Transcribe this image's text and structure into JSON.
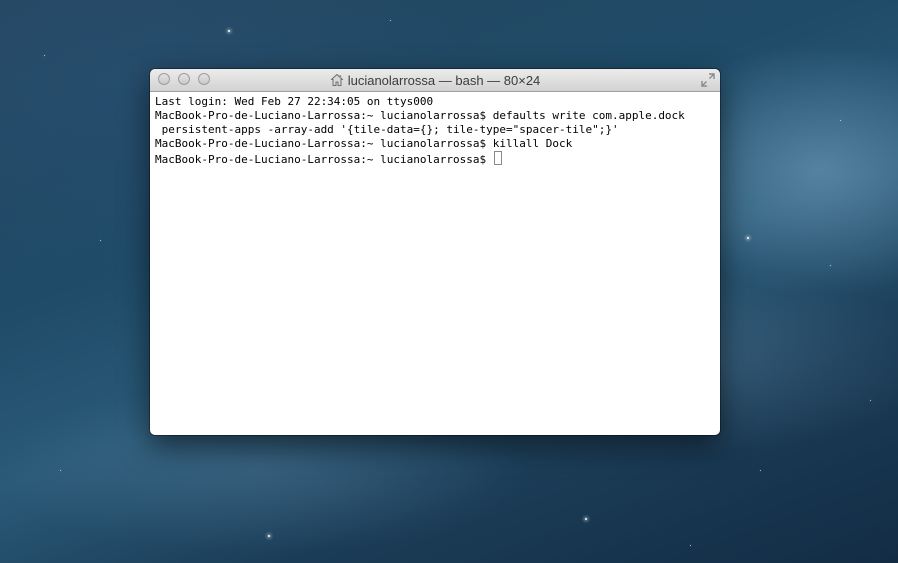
{
  "window": {
    "title": "lucianolarrossa — bash — 80×24"
  },
  "terminal": {
    "lines": [
      "Last login: Wed Feb 27 22:34:05 on ttys000",
      "MacBook-Pro-de-Luciano-Larrossa:~ lucianolarrossa$ defaults write com.apple.dock",
      " persistent-apps -array-add '{tile-data={}; tile-type=\"spacer-tile\";}'",
      "MacBook-Pro-de-Luciano-Larrossa:~ lucianolarrossa$ killall Dock",
      "MacBook-Pro-de-Luciano-Larrossa:~ lucianolarrossa$ "
    ]
  },
  "icons": {
    "title": "home-icon",
    "fullscreen": "fullscreen-arrows-icon"
  },
  "colors": {
    "terminal_background": "#ffffff",
    "terminal_text": "#000000"
  }
}
